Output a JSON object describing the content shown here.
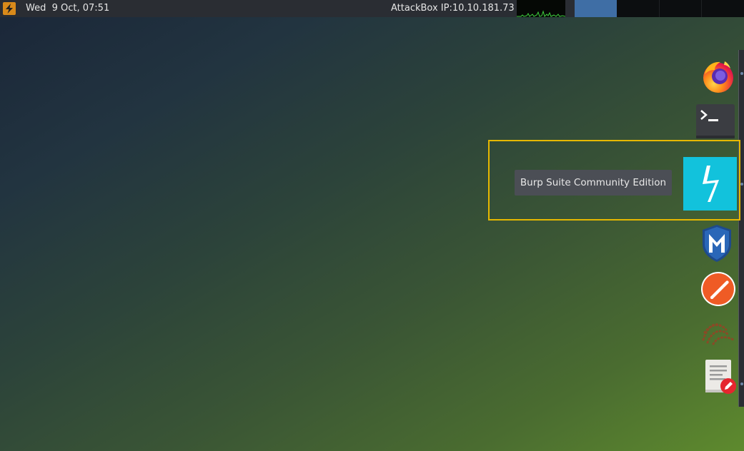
{
  "top_panel": {
    "app_icon": "lightning-bolt-icon",
    "clock": "Wed  9 Oct, 07:51",
    "ip_label": "AttackBox IP:10.10.181.73",
    "workspace_active_color": "#3f6ea5"
  },
  "dock": {
    "items": [
      {
        "name": "Firefox",
        "icon": "firefox-icon"
      },
      {
        "name": "Terminal",
        "icon": "terminal-icon"
      },
      {
        "name": "Burp Suite Community Edition",
        "icon": "burp-suite-icon"
      },
      {
        "name": "Metasploit",
        "icon": "metasploit-icon"
      },
      {
        "name": "Postman",
        "icon": "postman-icon"
      },
      {
        "name": "Proxy",
        "icon": "proxy-icon"
      },
      {
        "name": "Text Editor",
        "icon": "text-editor-icon"
      }
    ],
    "tooltip": "Burp Suite Community Edition",
    "highlight_color": "#e6b800",
    "burp_color": "#12c2dc"
  }
}
